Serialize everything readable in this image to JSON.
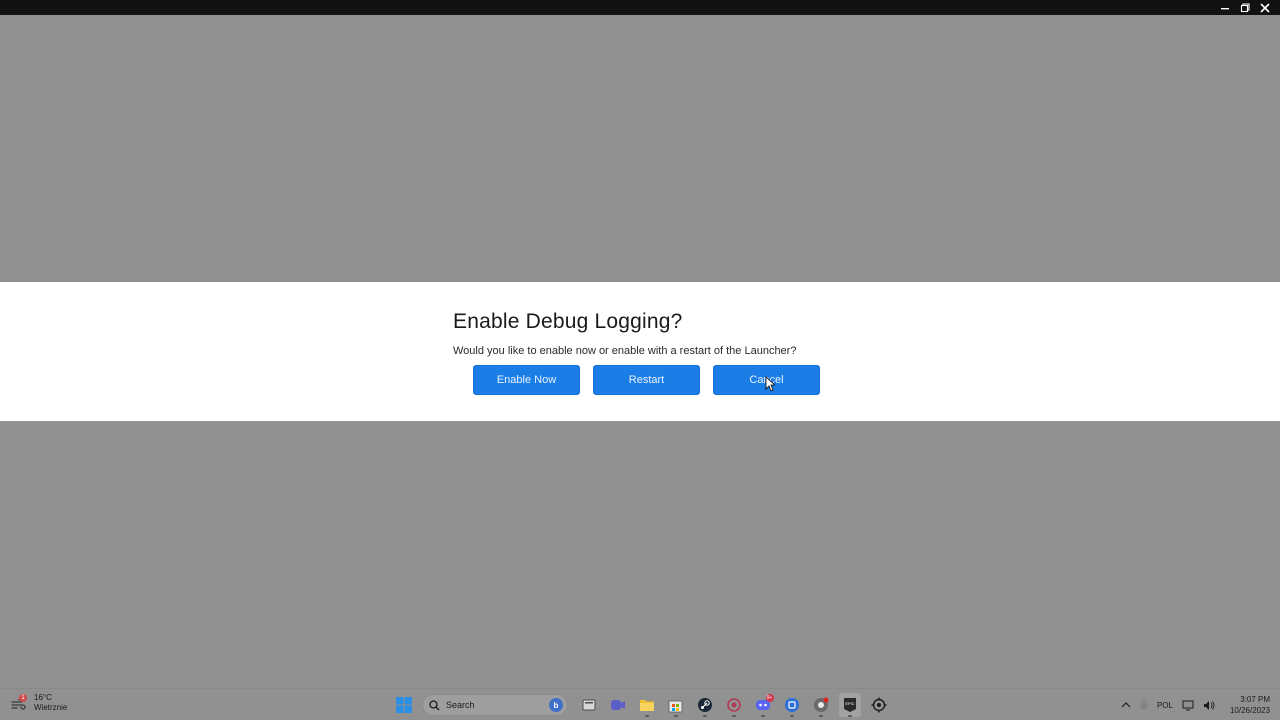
{
  "window": {
    "controls": {
      "minimize": "minimize-icon",
      "restore": "restore-icon",
      "close": "close-icon"
    }
  },
  "dialog": {
    "title": "Enable Debug Logging?",
    "message": "Would you like to enable now or enable with a restart of the Launcher?",
    "buttons": {
      "enable_now": "Enable Now",
      "restart": "Restart",
      "cancel": "Cancel"
    },
    "accent_color": "#1a7ee6"
  },
  "taskbar": {
    "weather": {
      "temperature": "16°C",
      "condition": "Wietrznie",
      "badge": "1"
    },
    "search": {
      "placeholder": "Search"
    },
    "apps": [
      {
        "name": "start-icon"
      },
      {
        "name": "task-view-icon"
      },
      {
        "name": "meet-icon"
      },
      {
        "name": "file-explorer-icon"
      },
      {
        "name": "store-icon"
      },
      {
        "name": "steam-icon"
      },
      {
        "name": "app-circle-icon"
      },
      {
        "name": "discord-icon",
        "badge": "9+"
      },
      {
        "name": "app-blue-icon"
      },
      {
        "name": "chrome-icon"
      },
      {
        "name": "epic-games-icon"
      },
      {
        "name": "settings-gear-icon"
      }
    ],
    "tray": {
      "language": "POL",
      "time": "3:07 PM",
      "date": "10/26/2023"
    }
  }
}
